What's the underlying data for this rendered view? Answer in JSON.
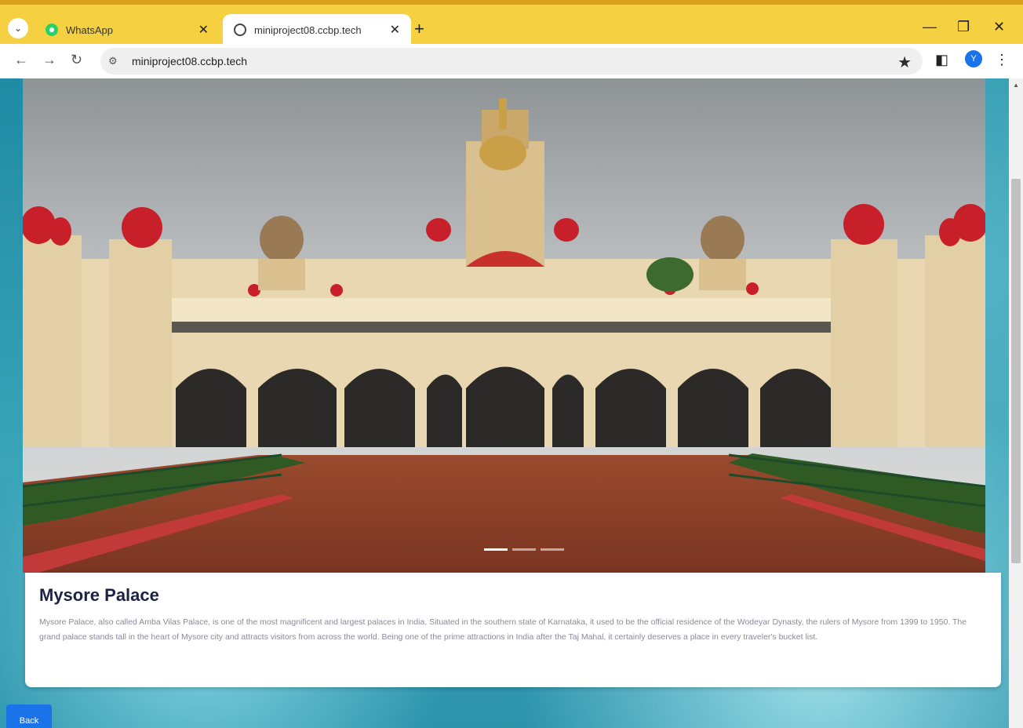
{
  "browser": {
    "tabs": [
      {
        "title": "WhatsApp",
        "icon": "whatsapp-icon",
        "active": false
      },
      {
        "title": "miniproject08.ccbp.tech",
        "icon": "globe-icon",
        "active": true
      }
    ],
    "new_tab_label": "+",
    "url": "miniproject08.ccbp.tech",
    "profile_initial": "Y"
  },
  "hero": {
    "image_subject": "Mysore Palace",
    "carousel_slides": 3,
    "active_slide": 1
  },
  "card": {
    "title": "Mysore Palace",
    "description": "Mysore Palace, also called Amba Vilas Palace, is one of the most magnificent and largest palaces in India. Situated in the southern state of Karnataka, it used to be the official residence of the Wodeyar Dynasty, the rulers of Mysore from 1399 to 1950. The grand palace stands tall in the heart of Mysore city and attracts visitors from across the world. Being one of the prime attractions in India after the Taj Mahal, it certainly deserves a place in every traveler's bucket list."
  },
  "back_button": {
    "label": "Back"
  },
  "colors": {
    "tab_strip": "#f5d142",
    "page_background": "#2a8aa3",
    "button": "#1a73e8",
    "title_text": "#1c2242"
  }
}
